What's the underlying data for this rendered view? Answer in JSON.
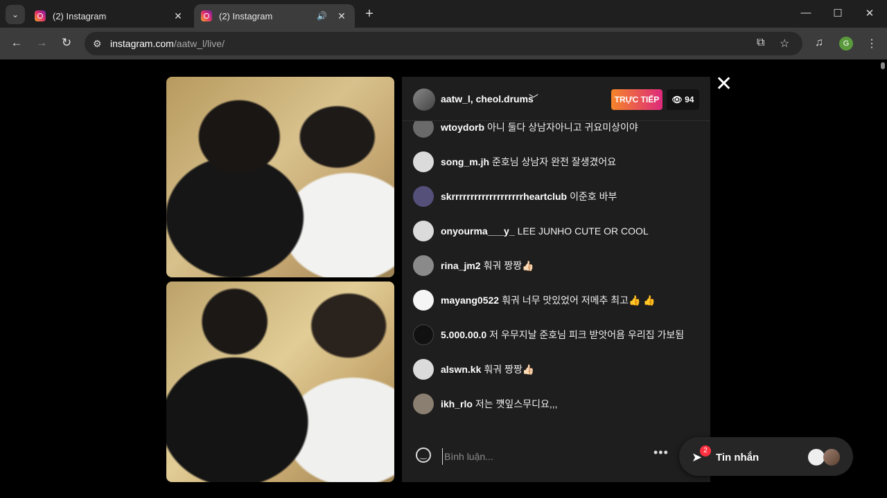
{
  "browser": {
    "tabs": [
      {
        "title": "(2) Instagram",
        "active": false
      },
      {
        "title": "(2) Instagram",
        "active": true
      }
    ],
    "url_host": "instagram.com",
    "url_path": "/aatw_l/live/",
    "profile_initial": "G"
  },
  "live": {
    "hosts": "aatw_l, cheol.drums",
    "live_label": "TRỰC TIẾP",
    "viewer_count": "94"
  },
  "comments": [
    {
      "user": "wtoydorb",
      "text": "아니 둘다 상남자아니고 귀요미상이야",
      "avatar_color": "#6a6a6a"
    },
    {
      "user": "song_m.jh",
      "text": "준호님 상남자 완전 잘생겼어요",
      "avatar_color": "#dbdbdb"
    },
    {
      "user": "skrrrrrrrrrrrrrrrrrrrheartclub",
      "text": "이준호 바부",
      "avatar_color": "#55507a"
    },
    {
      "user": "onyourma___y_",
      "text": "LEE JUNHO CUTE OR COOL",
      "avatar_color": "#dbdbdb"
    },
    {
      "user": "rina_jm2",
      "text": "훠궈 짱짱👍🏻",
      "avatar_color": "#8a8a8a"
    },
    {
      "user": "mayang0522",
      "text": "훠궈 너무 맛있었어 저메추 최고👍 👍",
      "avatar_color": "#f5f5f5"
    },
    {
      "user": "5.000.00.0",
      "text": "저 우무지날 준호님 피크 받앗어욤 우리집 가보됨",
      "avatar_color": "#111111"
    },
    {
      "user": "alswn.kk",
      "text": "훠궈 짱짱👍🏻",
      "avatar_color": "#dbdbdb"
    },
    {
      "user": "ikh_rlo",
      "text": "저는 꺳잎스무디요,,,",
      "avatar_color": "#8a7f70"
    }
  ],
  "input": {
    "placeholder": "Bình luận..."
  },
  "messages": {
    "label": "Tin nhắn",
    "badge": "2"
  },
  "icons": {
    "tab_search": "chevron-down-icon",
    "close": "close-icon",
    "eye": "eye-icon",
    "emoji": "smiley-icon",
    "more": "ellipsis-icon",
    "messages": "paper-plane-icon"
  }
}
